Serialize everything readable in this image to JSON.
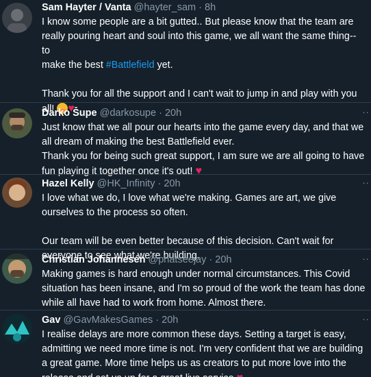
{
  "tweets": [
    {
      "name": "Sam Hayter / Vanta",
      "handle": "@hayter_sam",
      "dot": "·",
      "time": "8h",
      "body_before_hashtag": "I know some people are a bit gutted.. But please know that the team are\nreally pouring heart and soul into this game, we all want the same thing-- to\nmake the best ",
      "hashtag": "#Battlefield",
      "body_after_hashtag": " yet.\n\nThank you for all the support and I can't wait to jump in and play with you\nall! ",
      "heart": "♥",
      "emoji_icon": "smiling-face-with-hearts-icon",
      "avatar_icon": "avatar-image"
    },
    {
      "name": "Darko Šupe",
      "handle": "@darkosupe",
      "dot": "·",
      "time": "20h",
      "body": "Just know that we all pour our hearts into the game every day, and that we\nall dream of making the best Battlefield ever.\nThank you for being such great support, I am sure we are all going to have\nfun playing it together once it's out! ",
      "heart": "♥",
      "more": "··"
    },
    {
      "name": "Hazel Kelly",
      "handle": "@HK_Infinity",
      "dot": "·",
      "time": "20h",
      "body": "I love what we do, I love what we're making. Games are art, we give\nourselves to the process so often.\n\nOur team will be even better because of this decision. Can't wait for\neveryone to see what we're building.",
      "more": "··"
    },
    {
      "name": "Christian Johannesén",
      "handle": "@phatseejay",
      "dot": "·",
      "time": "20h",
      "body": "Making games is hard enough under normal circumstances. This Covid\nsituation has been insane, and I'm so proud of the work the team has done\nwhile all have had to work from home. Almost there.",
      "more": "··"
    },
    {
      "name": "Gav",
      "handle": "@GavMakesGames",
      "dot": "·",
      "time": "20h",
      "body": "I realise delays are more common these days. Setting a target is easy,\nadmitting we need more time is not. I'm very confident that we are building\na great game. More time helps us as creators to put more love into the\nrelease and set us up for a great live service ",
      "heart": "♥",
      "more": "··"
    }
  ],
  "colors": {
    "background": "#15202b",
    "secondary_text": "#8899a6",
    "hashtag": "#1d9bf0",
    "heart": "#e0245e"
  }
}
